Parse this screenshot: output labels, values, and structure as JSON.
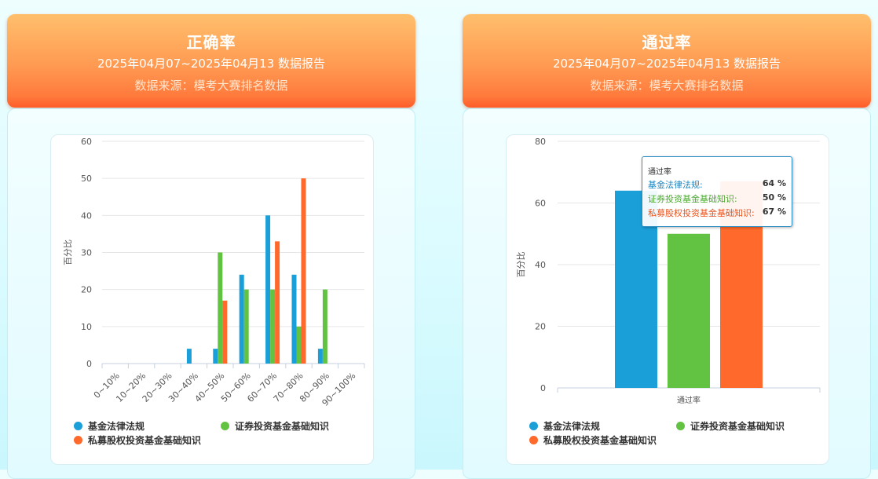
{
  "colors": {
    "series1": "#1a9fd8",
    "series2": "#62c342",
    "series3": "#ff6a2c"
  },
  "panels": [
    {
      "title": "正确率",
      "date_range": "2025年04月07~2025年04月13 数据报告",
      "source": "数据来源：模考大赛排名数据"
    },
    {
      "title": "通过率",
      "date_range": "2025年04月07~2025年04月13 数据报告",
      "source": "数据来源：模考大赛排名数据"
    }
  ],
  "chart_data": [
    {
      "type": "bar",
      "ylabel": "百分比",
      "ylim": [
        0,
        60
      ],
      "yticks": [
        0,
        10,
        20,
        30,
        40,
        50,
        60
      ],
      "categories": [
        "0~10%",
        "10~20%",
        "20~30%",
        "30~40%",
        "40~50%",
        "50~60%",
        "60~70%",
        "70~80%",
        "80~90%",
        "90~100%"
      ],
      "series": [
        {
          "name": "基金法律法规",
          "values": [
            0,
            0,
            0,
            4,
            4,
            24,
            40,
            24,
            4,
            0
          ]
        },
        {
          "name": "证券投资基金基础知识",
          "values": [
            0,
            0,
            0,
            0,
            30,
            20,
            20,
            10,
            20,
            0
          ]
        },
        {
          "name": "私募股权投资基金基础知识",
          "values": [
            0,
            0,
            0,
            0,
            17,
            0,
            33,
            50,
            0,
            0
          ]
        }
      ],
      "legend": "bottom"
    },
    {
      "type": "bar",
      "ylabel": "百分比",
      "xlabel": "通过率",
      "ylim": [
        0,
        80
      ],
      "yticks": [
        0,
        20,
        40,
        60,
        80
      ],
      "categories": [
        "通过率"
      ],
      "series": [
        {
          "name": "基金法律法规",
          "values": [
            64
          ]
        },
        {
          "name": "证券投资基金基础知识",
          "values": [
            50
          ]
        },
        {
          "name": "私募股权投资基金基础知识",
          "values": [
            67
          ]
        }
      ],
      "legend": "bottom",
      "tooltip": {
        "title": "通过率",
        "rows": [
          {
            "name": "基金法律法规:",
            "value": "64 %"
          },
          {
            "name": "证券投资基金基础知识:",
            "value": "50 %"
          },
          {
            "name": "私募股权投资基金基础知识:",
            "value": "67 %"
          }
        ]
      }
    }
  ]
}
